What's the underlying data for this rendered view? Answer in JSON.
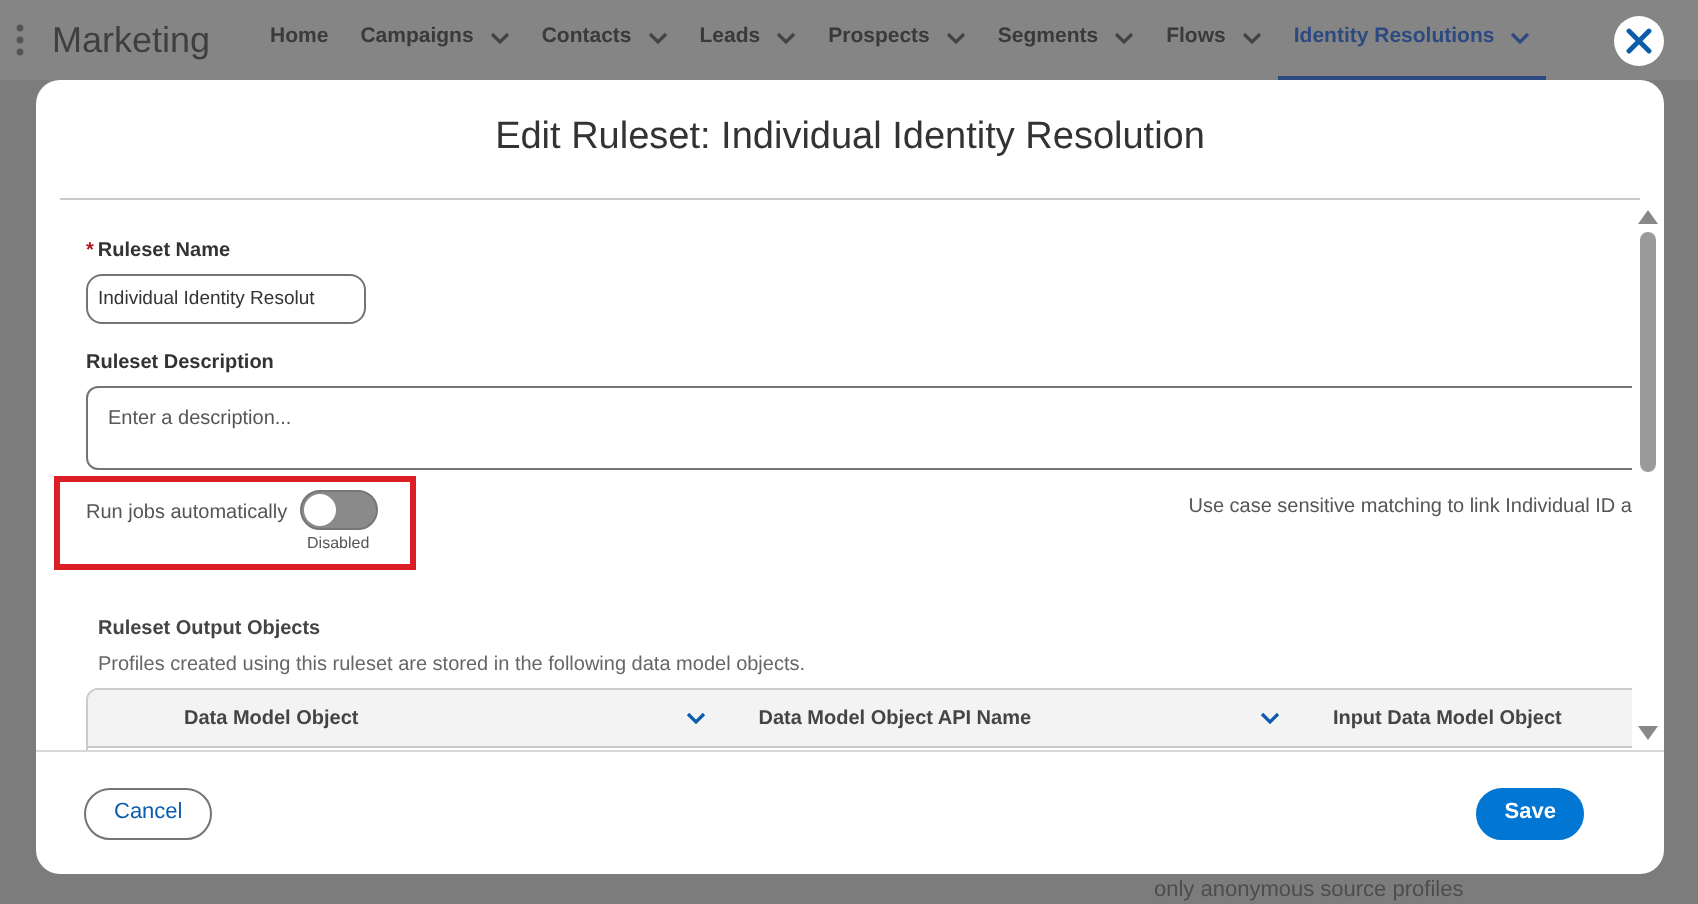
{
  "app": {
    "title": "Marketing",
    "nav": [
      {
        "label": "Home",
        "dropdown": false,
        "selected": false
      },
      {
        "label": "Campaigns",
        "dropdown": true,
        "selected": false
      },
      {
        "label": "Contacts",
        "dropdown": true,
        "selected": false
      },
      {
        "label": "Leads",
        "dropdown": true,
        "selected": false
      },
      {
        "label": "Prospects",
        "dropdown": true,
        "selected": false
      },
      {
        "label": "Segments",
        "dropdown": true,
        "selected": false
      },
      {
        "label": "Flows",
        "dropdown": true,
        "selected": false
      },
      {
        "label": "Identity Resolutions",
        "dropdown": true,
        "selected": true
      }
    ],
    "background_text": "only anonymous source profiles"
  },
  "modal": {
    "title": "Edit Ruleset: Individual Identity Resolution",
    "name_field": {
      "label": "Ruleset Name",
      "required_mark": "*",
      "value": "Individual Identity Resolut"
    },
    "description_field": {
      "label": "Ruleset Description",
      "placeholder": "Enter a description..."
    },
    "run_jobs": {
      "label": "Run jobs automatically",
      "checked": false,
      "state_text": "Disabled",
      "highlighted": true
    },
    "case_sensitive_text": "Use case sensitive matching to link Individual ID a",
    "output_objects": {
      "title": "Ruleset Output Objects",
      "description": "Profiles created using this ruleset are stored in the following data model objects.",
      "columns": [
        {
          "label": "Data Model Object",
          "sortable": true
        },
        {
          "label": "Data Model Object API Name",
          "sortable": true
        },
        {
          "label": "Input Data Model Object",
          "sortable": false
        }
      ]
    },
    "buttons": [
      {
        "label": "Cancel",
        "kind": "neutral"
      },
      {
        "label": "Save",
        "kind": "brand"
      }
    ]
  }
}
